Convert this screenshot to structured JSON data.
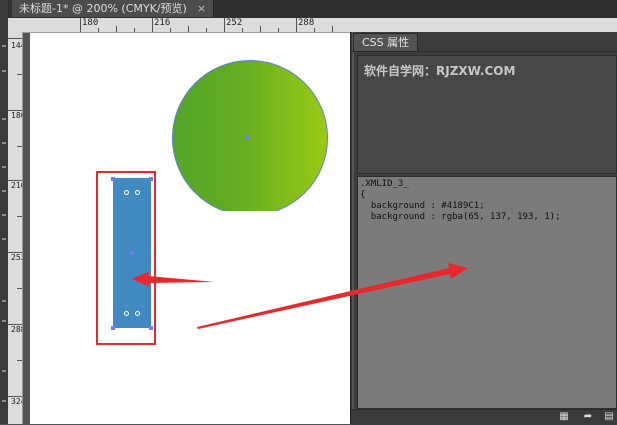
{
  "document_tab": {
    "title": "未标题-1* @ 200% (CMYK/预览)",
    "close": "×"
  },
  "ruler": {
    "h_labels": [
      "180",
      "216",
      "252",
      "288"
    ],
    "v_labels": [
      "144",
      "180",
      "216",
      "252",
      "288",
      "324"
    ]
  },
  "shapes": {
    "circle_gradient": [
      "#55a52a",
      "#99c913"
    ],
    "rect_fill": "#4189C1",
    "highlight_color": "#e8282d"
  },
  "css_panel": {
    "tab_label": "CSS 属性",
    "watermark": "软件自学网：RJZXW.COM",
    "code_lines": [
      ".XMLID_3_",
      "{",
      "  background : #4189C1;",
      "  background : rgba(65, 137, 193, 1);"
    ],
    "footer_icons": [
      "export-icon",
      "share-icon",
      "menu-icon"
    ]
  }
}
